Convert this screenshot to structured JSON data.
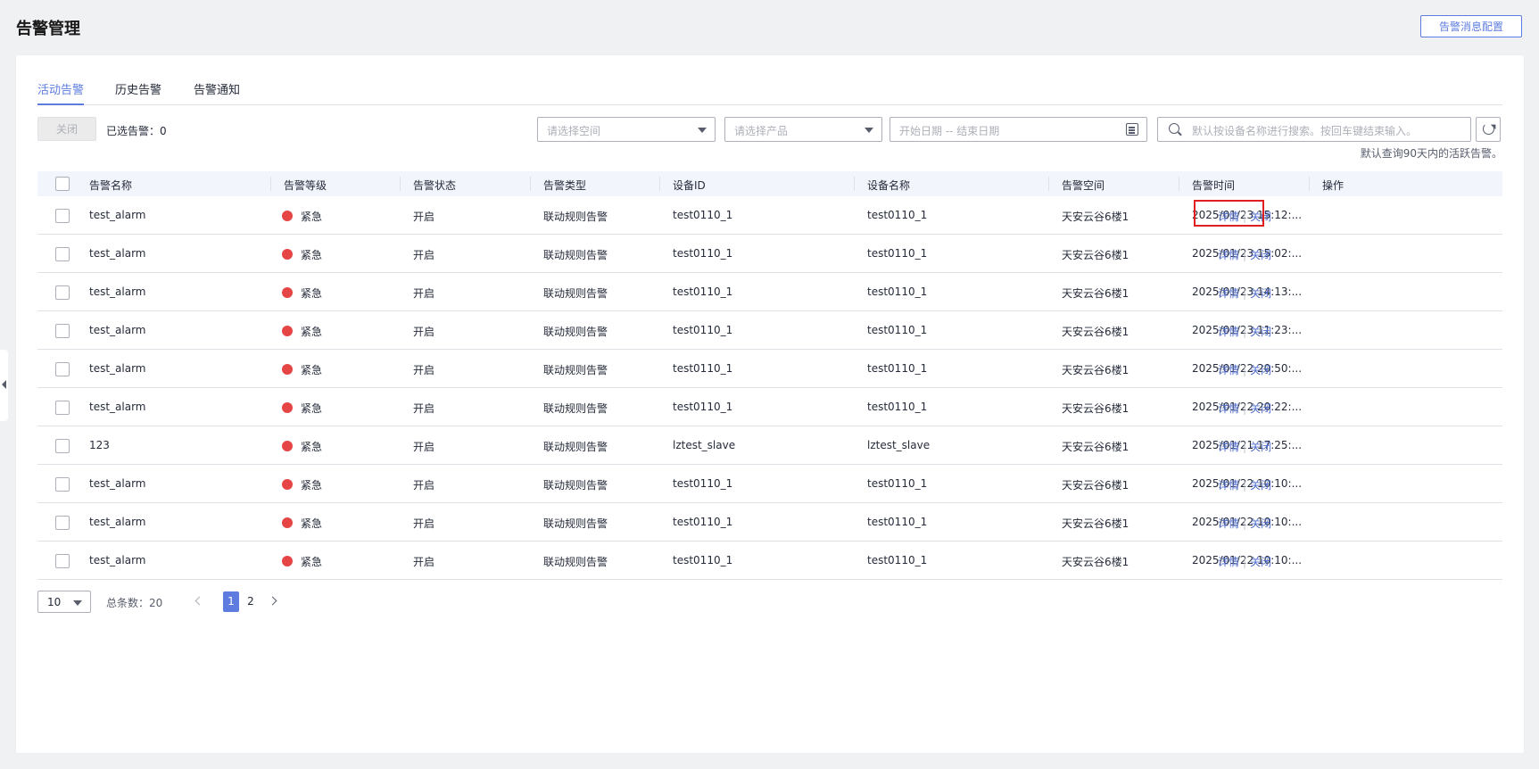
{
  "header": {
    "title": "告警管理",
    "config_button": "告警消息配置"
  },
  "tabs": [
    {
      "label": "活动告警",
      "active": true
    },
    {
      "label": "历史告警",
      "active": false
    },
    {
      "label": "告警通知",
      "active": false
    }
  ],
  "toolbar": {
    "close_button": "关闭",
    "selected_count": "已选告警：0",
    "space_placeholder": "请选择空间",
    "product_placeholder": "请选择产品",
    "date_placeholder": "开始日期 -- 结束日期",
    "search_placeholder": "默认按设备名称进行搜索。按回车键结束输入。",
    "hint": "默认查询90天内的活跃告警。"
  },
  "table": {
    "columns": [
      "告警名称",
      "告警等级",
      "告警状态",
      "告警类型",
      "设备ID",
      "设备名称",
      "告警空间",
      "告警时间",
      "操作"
    ],
    "rows": [
      {
        "name": "test_alarm",
        "level": "紧急",
        "status": "开启",
        "type": "联动规则告警",
        "device_id": "test0110_1",
        "device_name": "test0110_1",
        "space": "天安云谷6楼1",
        "time": "2025/01/23 15:12:...",
        "detail": "详情",
        "close": "关闭"
      },
      {
        "name": "test_alarm",
        "level": "紧急",
        "status": "开启",
        "type": "联动规则告警",
        "device_id": "test0110_1",
        "device_name": "test0110_1",
        "space": "天安云谷6楼1",
        "time": "2025/01/23 15:02:...",
        "detail": "详情",
        "close": "关闭"
      },
      {
        "name": "test_alarm",
        "level": "紧急",
        "status": "开启",
        "type": "联动规则告警",
        "device_id": "test0110_1",
        "device_name": "test0110_1",
        "space": "天安云谷6楼1",
        "time": "2025/01/23 14:13:...",
        "detail": "详情",
        "close": "关闭"
      },
      {
        "name": "test_alarm",
        "level": "紧急",
        "status": "开启",
        "type": "联动规则告警",
        "device_id": "test0110_1",
        "device_name": "test0110_1",
        "space": "天安云谷6楼1",
        "time": "2025/01/23 11:23:...",
        "detail": "详情",
        "close": "关闭"
      },
      {
        "name": "test_alarm",
        "level": "紧急",
        "status": "开启",
        "type": "联动规则告警",
        "device_id": "test0110_1",
        "device_name": "test0110_1",
        "space": "天安云谷6楼1",
        "time": "2025/01/22 20:50:...",
        "detail": "详情",
        "close": "关闭"
      },
      {
        "name": "test_alarm",
        "level": "紧急",
        "status": "开启",
        "type": "联动规则告警",
        "device_id": "test0110_1",
        "device_name": "test0110_1",
        "space": "天安云谷6楼1",
        "time": "2025/01/22 20:22:...",
        "detail": "详情",
        "close": "关闭"
      },
      {
        "name": "123",
        "level": "紧急",
        "status": "开启",
        "type": "联动规则告警",
        "device_id": "lztest_slave",
        "device_name": "lztest_slave",
        "space": "天安云谷6楼1",
        "time": "2025/01/21 17:25:...",
        "detail": "详情",
        "close": "关闭"
      },
      {
        "name": "test_alarm",
        "level": "紧急",
        "status": "开启",
        "type": "联动规则告警",
        "device_id": "test0110_1",
        "device_name": "test0110_1",
        "space": "天安云谷6楼1",
        "time": "2025/01/22 10:10:...",
        "detail": "详情",
        "close": "关闭"
      },
      {
        "name": "test_alarm",
        "level": "紧急",
        "status": "开启",
        "type": "联动规则告警",
        "device_id": "test0110_1",
        "device_name": "test0110_1",
        "space": "天安云谷6楼1",
        "time": "2025/01/22 10:10:...",
        "detail": "详情",
        "close": "关闭"
      },
      {
        "name": "test_alarm",
        "level": "紧急",
        "status": "开启",
        "type": "联动规则告警",
        "device_id": "test0110_1",
        "device_name": "test0110_1",
        "space": "天安云谷6楼1",
        "time": "2025/01/22 10:10:...",
        "detail": "详情",
        "close": "关闭"
      }
    ]
  },
  "pagination": {
    "page_size": "10",
    "total": "总条数：20",
    "pages": [
      "1",
      "2"
    ],
    "current": "1"
  },
  "colors": {
    "accent": "#5e7ce0",
    "link": "#526ecc",
    "urgent": "#e54545",
    "highlight": "#e02020"
  }
}
